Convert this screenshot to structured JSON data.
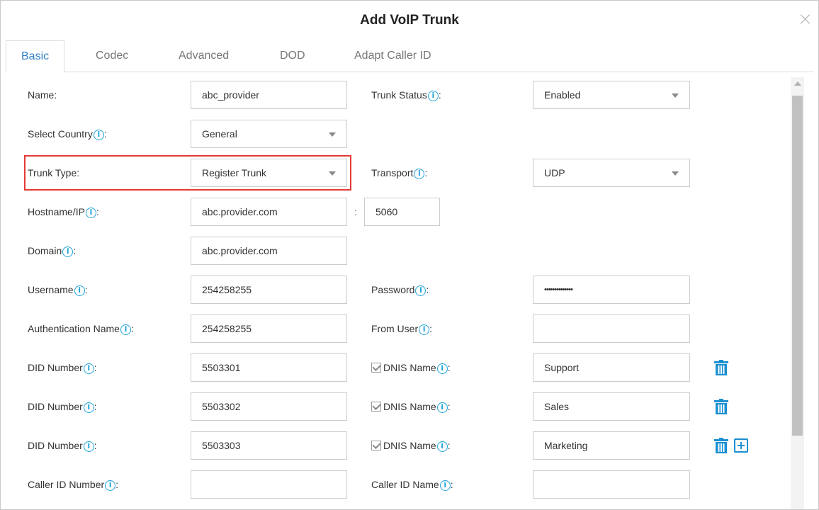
{
  "dialog": {
    "title": "Add VoIP Trunk"
  },
  "tabs": [
    "Basic",
    "Codec",
    "Advanced",
    "DOD",
    "Adapt Caller ID"
  ],
  "form": {
    "name_label": "Name:",
    "name_value": "abc_provider",
    "trunk_status_label": "Trunk Status",
    "trunk_status_value": "Enabled",
    "country_label": "Select Country",
    "country_value": "General",
    "trunk_type_label": "Trunk Type:",
    "trunk_type_value": "Register Trunk",
    "transport_label": "Transport",
    "transport_value": "UDP",
    "hostname_label": "Hostname/IP",
    "hostname_value": "abc.provider.com",
    "port_value": "5060",
    "domain_label": "Domain",
    "domain_value": "abc.provider.com",
    "username_label": "Username",
    "username_value": "254258255",
    "password_label": "Password",
    "password_value": "••••••••••••••",
    "auth_name_label": "Authentication Name",
    "auth_name_value": "254258255",
    "from_user_label": "From User",
    "from_user_value": "",
    "did_rows": [
      {
        "label": "DID Number",
        "value": "5503301",
        "dnis_label": "DNIS Name",
        "dnis_value": "Support"
      },
      {
        "label": "DID Number",
        "value": "5503302",
        "dnis_label": "DNIS Name",
        "dnis_value": "Sales"
      },
      {
        "label": "DID Number",
        "value": "5503303",
        "dnis_label": "DNIS Name",
        "dnis_value": "Marketing"
      }
    ],
    "caller_id_number_label": "Caller ID Number",
    "caller_id_number_value": "",
    "caller_id_name_label": "Caller ID Name",
    "caller_id_name_value": ""
  },
  "colors": {
    "accent": "#2f7fc8",
    "info": "#1ea3dc",
    "highlight": "#e53935",
    "icon": "#1a8fd0"
  },
  "icons": {
    "info": "info-circle-icon",
    "trash": "trash-icon",
    "add": "plus-square-icon",
    "close": "close-icon",
    "check": "checkbox-checked-icon"
  }
}
